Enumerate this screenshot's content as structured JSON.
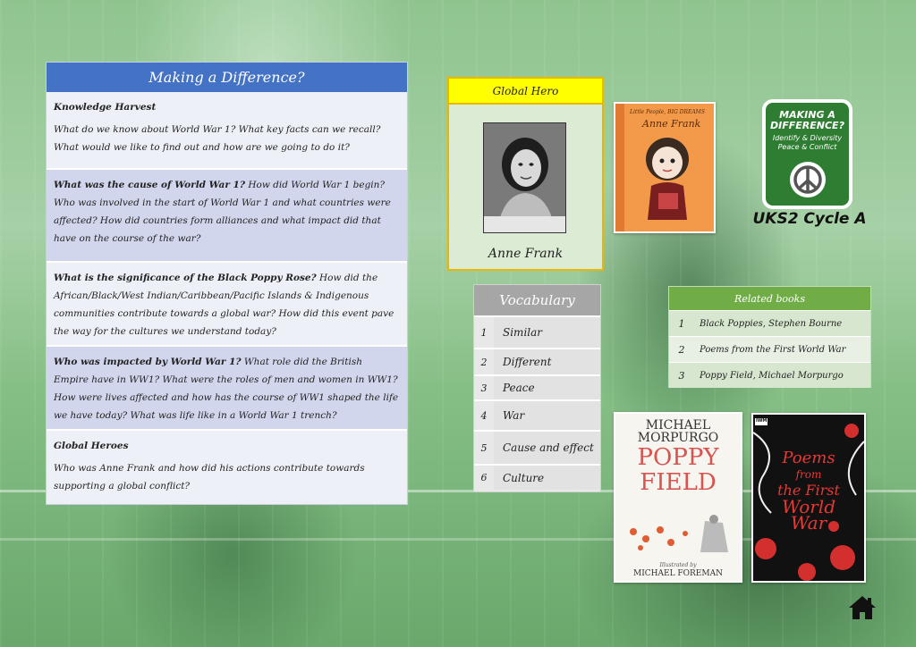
{
  "main": {
    "title": "Making a Difference?",
    "sections": [
      {
        "heading": "Knowledge Harvest",
        "text": "What do we know about World War 1? What key facts can we recall? What would we like to find out and how are we going to do it?"
      },
      {
        "bold_lead": "What was the cause of World War 1?",
        "text": " How did World War 1 begin? Who was involved in the start of World War 1 and what countries were affected? How did countries form alliances and what impact did that have on the course of the war?"
      },
      {
        "bold_lead": "What is the significance of the Black Poppy Rose?",
        "text": " How did the African/Black/West Indian/Caribbean/Pacific Islands & Indigenous communities contribute towards a global war? How did this event pave the way for the cultures we understand today?"
      },
      {
        "bold_lead": "Who was impacted by World War 1?",
        "text": " What role did the British Empire have in WW1? What were the roles of men and women in WW1? How were lives affected and how has the course of WW1 shaped the life we have today? What was life like in a World War 1 trench?"
      },
      {
        "heading": "Global Heroes",
        "text": "Who was Anne Frank and how did his actions contribute towards supporting a global conflict?"
      }
    ]
  },
  "hero": {
    "header": "Global Hero",
    "name": "Anne Frank"
  },
  "covers": {
    "anne_frank": {
      "series": "Little People, BIG DREAMS",
      "title": "Anne Frank"
    },
    "poppy_field": {
      "author": "MICHAEL MORPURGO",
      "title_line1": "POPPY",
      "title_line2": "FIELD",
      "illustrated_by": "Illustrated by",
      "illustrator": "MICHAEL FOREMAN"
    },
    "poems": {
      "title_line1": "Poems",
      "title_line2": "from",
      "title_line3": "the First",
      "title_line4": "World",
      "title_line5": "War",
      "publisher": "IWM"
    }
  },
  "badge": {
    "title": "MAKING A DIFFERENCE?",
    "subtitle_line1": "Identify & Diversity",
    "subtitle_line2": "Peace & Conflict",
    "caption": "UKS2 Cycle A",
    "color": "#2e7d32"
  },
  "vocabulary": {
    "title": "Vocabulary",
    "items": [
      {
        "n": "1",
        "word": "Similar"
      },
      {
        "n": "2",
        "word": "Different"
      },
      {
        "n": "3",
        "word": "Peace"
      },
      {
        "n": "4",
        "word": "War"
      },
      {
        "n": "5",
        "word": "Cause and effect"
      },
      {
        "n": "6",
        "word": "Culture"
      }
    ]
  },
  "related_books": {
    "title": "Related books",
    "items": [
      {
        "n": "1",
        "title": "Black Poppies, Stephen Bourne"
      },
      {
        "n": "2",
        "title": "Poems from the First World War"
      },
      {
        "n": "3",
        "title": "Poppy Field, Michael Morpurgo"
      }
    ]
  },
  "nav": {
    "home_icon": "home-icon"
  }
}
